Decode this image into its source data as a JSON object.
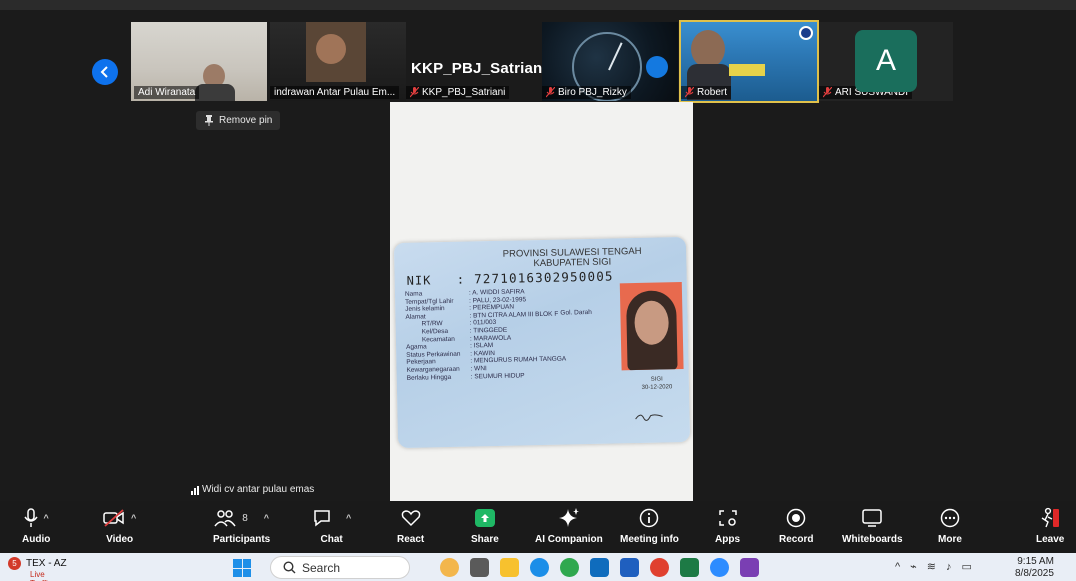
{
  "meeting": {
    "pinned_title": "KKP_PBJ_Satriani",
    "remove_pin": "Remove pin",
    "active_speaker": "Widi cv antar pulau emas"
  },
  "participants_strip": [
    {
      "name": "Adi Wiranata",
      "muted": false
    },
    {
      "name": "indrawan Antar Pulau Em...",
      "muted": false
    },
    {
      "name": "KKP_PBJ_Satriani",
      "muted": true
    },
    {
      "name": "Biro PBJ_Rizky",
      "muted": true
    },
    {
      "name": "Robert",
      "muted": true
    },
    {
      "name": "ARI SUSWANDI",
      "muted": true,
      "avatar_letter": "A"
    }
  ],
  "ktp": {
    "province": "PROVINSI SULAWESI TENGAH",
    "regency": "KABUPATEN SIGI",
    "nik_label": "NIK",
    "nik": ": 7271016302950005",
    "fields": [
      {
        "k": "Nama",
        "v": ": A. WIDDI SAFIRA"
      },
      {
        "k": "Tempat/Tgl Lahir",
        "v": ": PALU, 23-02-1995"
      },
      {
        "k": "Jenis kelamin",
        "v": ": PEREMPUAN"
      },
      {
        "k": "Alamat",
        "v": ": BTN CITRA ALAM III BLOK F"
      },
      {
        "k": "RT/RW",
        "v": ": 011/003"
      },
      {
        "k": "Kel/Desa",
        "v": ": TINGGEDE"
      },
      {
        "k": "Kecamatan",
        "v": ": MARAWOLA"
      },
      {
        "k": "Agama",
        "v": ": ISLAM"
      },
      {
        "k": "Status Perkawinan",
        "v": ": KAWIN"
      },
      {
        "k": "Pekerjaan",
        "v": ": MENGURUS RUMAH TANGGA"
      },
      {
        "k": "Kewarganegaraan",
        "v": ": WNI"
      },
      {
        "k": "Berlaku Hingga",
        "v": ": SEUMUR HIDUP"
      }
    ],
    "gol_darah": "Gol. Darah",
    "place": "SIGI",
    "date": "30-12-2020"
  },
  "toolbar": {
    "audio": "Audio",
    "video": "Video",
    "participants": "Participants",
    "participants_count": "8",
    "chat": "Chat",
    "react": "React",
    "share": "Share",
    "ai_companion": "AI Companion",
    "meeting_info": "Meeting info",
    "apps": "Apps",
    "record": "Record",
    "whiteboards": "Whiteboards",
    "more": "More",
    "leave": "Leave"
  },
  "taskbar": {
    "app_name": "TEX - AZ",
    "app_sub": "Live Traffic",
    "notif_count": "5",
    "search_placeholder": "Search",
    "time": "9:15 AM",
    "date": "8/8/2025"
  },
  "colors": {
    "zoom_blue": "#0e72ed",
    "share_green": "#1fb865",
    "leave_red": "#e02828",
    "muted_red": "#e03e3e"
  }
}
